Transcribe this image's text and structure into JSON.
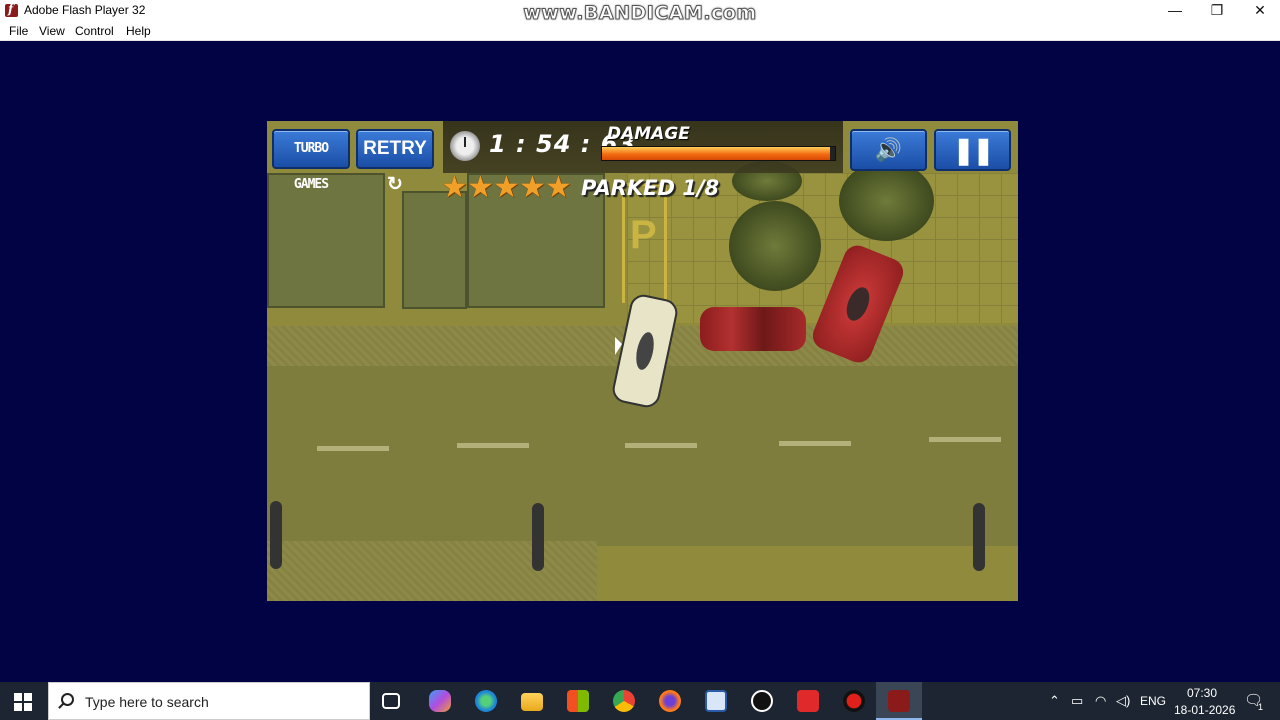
{
  "window": {
    "title": "Adobe Flash Player 32",
    "watermark": "www.BANDICAM.com",
    "minimize": "—",
    "restore": "❐",
    "close": "✕"
  },
  "menu": [
    "File",
    "View",
    "Control",
    "Help"
  ],
  "game": {
    "turbo_label": "TURBO GAMES",
    "retry_label": "RETRY ↻",
    "timer": "1 : 54 : 63",
    "damage_label": "DAMAGE",
    "damage_level": 0.98,
    "damage_color": "#f36b12",
    "stars_filled": 5,
    "parked": "PARKED 1/8",
    "parking_letter": "P",
    "sound_icon": "speaker-icon",
    "pause_icon": "pause-icon"
  },
  "taskbar": {
    "search_placeholder": "Type here to search",
    "language": "ENG",
    "time": "07:30",
    "date": "18-01-2026",
    "notification_count": "1",
    "background": "#1c2531"
  },
  "colors": {
    "player_background": "#020344",
    "hud_button": "#2a63c0"
  }
}
